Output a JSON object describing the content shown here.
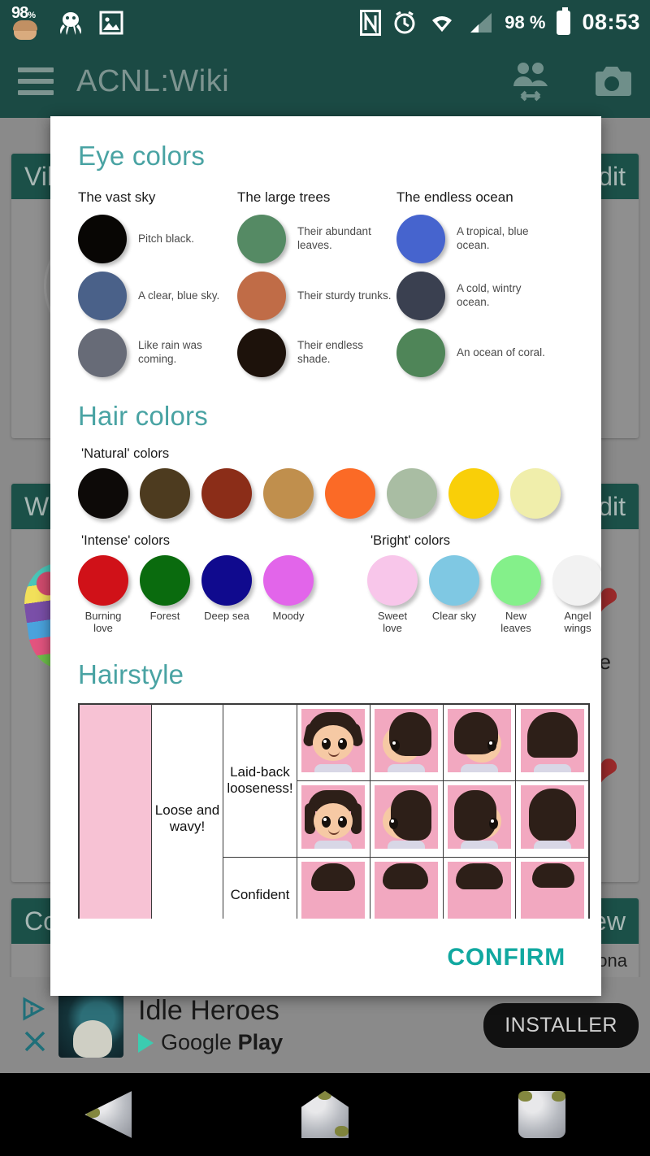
{
  "status_bar": {
    "notification_badge": "98",
    "notification_badge_unit": "%",
    "icons": [
      "avatar-badge-icon",
      "octopus-icon",
      "image-icon"
    ],
    "right_icons": [
      "nfc-icon",
      "alarm-icon",
      "wifi-icon",
      "signal-icon"
    ],
    "battery_percent": "98 %",
    "time": "08:53"
  },
  "app_bar": {
    "title": "ACNL:Wiki",
    "menu_icon": "hamburger-menu-icon",
    "actions": [
      "compare-villagers-icon",
      "camera-icon"
    ]
  },
  "background": {
    "cards": [
      {
        "title": "Villagers",
        "title_short": "Vill",
        "edit_label": "Edit"
      },
      {
        "title": "Wishlist",
        "title_short": "Wis",
        "edit_label": "Edit"
      },
      {
        "title": "Compare",
        "title_short": "Com",
        "action_label": "New"
      }
    ],
    "fragment_text": "e",
    "fragment_text2": "Epona"
  },
  "ad": {
    "title": "Idle Heroes",
    "store_prefix": "Google ",
    "store_suffix": "Play",
    "button_label": "INSTALLER"
  },
  "dialog": {
    "confirm_label": "CONFIRM",
    "eye": {
      "heading": "Eye colors",
      "columns": [
        {
          "title": "The vast sky",
          "entries": [
            {
              "label": "Pitch black.",
              "color": "#080604"
            },
            {
              "label": "A clear, blue sky.",
              "color": "#4a6189"
            },
            {
              "label": "Like rain was coming.",
              "color": "#676b77"
            }
          ]
        },
        {
          "title": "The large trees",
          "entries": [
            {
              "label": "Their abundant leaves.",
              "color": "#558a64"
            },
            {
              "label": "Their sturdy trunks.",
              "color": "#c06c47"
            },
            {
              "label": "Their endless shade.",
              "color": "#1d120b"
            }
          ]
        },
        {
          "title": "The endless ocean",
          "entries": [
            {
              "label": "A tropical, blue ocean.",
              "color": "#4664ce"
            },
            {
              "label": "A cold, wintry ocean.",
              "color": "#3a4050"
            },
            {
              "label": "An ocean of coral.",
              "color": "#4f8558"
            }
          ]
        }
      ]
    },
    "hair": {
      "heading": "Hair colors",
      "groups": [
        {
          "title": "'Natural' colors",
          "swatches": [
            {
              "name": "",
              "color": "#0d0a08"
            },
            {
              "name": "",
              "color": "#4d3b1f"
            },
            {
              "name": "",
              "color": "#8b2d18"
            },
            {
              "name": "",
              "color": "#c08f4d"
            },
            {
              "name": "",
              "color": "#fb6a26"
            },
            {
              "name": "",
              "color": "#a9bda3"
            },
            {
              "name": "",
              "color": "#f9cf08"
            },
            {
              "name": "",
              "color": "#f0eeab"
            }
          ]
        },
        {
          "title": "'Intense' colors",
          "swatches": [
            {
              "name": "Burning love",
              "color": "#d01118"
            },
            {
              "name": "Forest",
              "color": "#0a6b0e"
            },
            {
              "name": "Deep sea",
              "color": "#100a8e"
            },
            {
              "name": "Moody",
              "color": "#e265ea"
            }
          ]
        },
        {
          "title": "'Bright' colors",
          "swatches": [
            {
              "name": "Sweet love",
              "color": "#f8c6ea"
            },
            {
              "name": "Clear sky",
              "color": "#7fc8e3"
            },
            {
              "name": "New leaves",
              "color": "#84f08a"
            },
            {
              "name": "Angel wings",
              "color": "#f2f2f2"
            }
          ]
        }
      ]
    },
    "hairstyle": {
      "heading": "Hairstyle",
      "group_label": "Loose and wavy!",
      "rows": [
        {
          "category": "Laid-back looseness!",
          "views": [
            "front",
            "side",
            "back-side",
            "back"
          ]
        },
        {
          "category": "",
          "views": [
            "front",
            "side",
            "back-side",
            "back"
          ]
        },
        {
          "category": "Confident",
          "views": [
            "front",
            "side",
            "back-side",
            "back"
          ]
        }
      ]
    }
  },
  "colors": {
    "accent_teal": "#11a8a0",
    "heading_teal": "#49a3a3",
    "appbar_green": "#1b4a44",
    "pink_column": "#f7c2d4"
  }
}
